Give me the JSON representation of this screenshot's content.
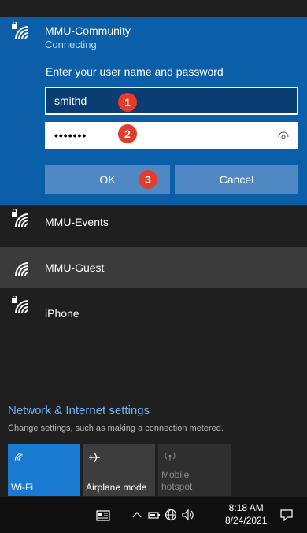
{
  "active_network": {
    "name": "MMU-Community",
    "status": "Connecting",
    "prompt": "Enter your user name and password",
    "username_value": "smithd",
    "password_masked": "•••••••",
    "ok_label": "OK",
    "cancel_label": "Cancel",
    "badges": [
      "1",
      "2",
      "3"
    ]
  },
  "networks": [
    {
      "name": "MMU-Events",
      "secured": true
    },
    {
      "name": "MMU-Guest",
      "secured": false
    },
    {
      "name": "iPhone",
      "secured": true
    }
  ],
  "settings": {
    "title": "Network & Internet settings",
    "subtitle": "Change settings, such as making a connection metered."
  },
  "quick_actions": [
    {
      "label": "Wi-Fi",
      "icon": "wifi-icon",
      "state": "on"
    },
    {
      "label": "Airplane mode",
      "icon": "airplane-icon",
      "state": "off"
    },
    {
      "label": "Mobile\nhotspot",
      "icon": "hotspot-icon",
      "state": "disabled"
    }
  ],
  "taskbar": {
    "time": "8:18 AM",
    "date": "8/24/2021"
  },
  "colors": {
    "accent": "#0b5ea8",
    "badge": "#e23c2b",
    "link": "#6cb3f5"
  }
}
